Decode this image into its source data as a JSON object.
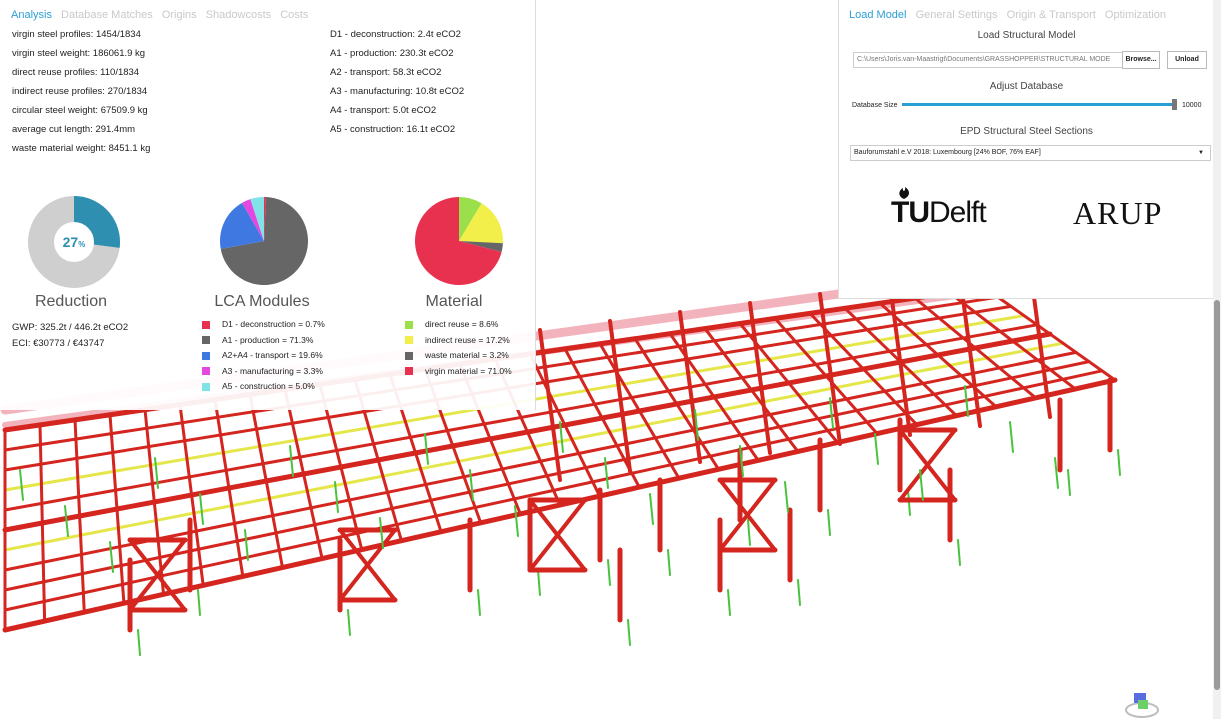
{
  "left": {
    "tabs": [
      "Analysis",
      "Database Matches",
      "Origins",
      "Shadowcosts",
      "Costs"
    ],
    "stats": [
      "virgin steel profiles: 1454/1834",
      "virgin steel weight: 186061.9 kg",
      "direct reuse profiles: 110/1834",
      "indirect reuse profiles: 270/1834",
      "circular steel weight: 67509.9 kg",
      "average cut length: 291.4mm",
      "waste material weight: 8451.1 kg"
    ],
    "lca_stats": [
      "D1 - deconstruction: 2.4t eCO2",
      "A1 - production: 230.3t eCO2",
      "A2 - transport: 58.3t eCO2",
      "A3 - manufacturing: 10.8t eCO2",
      "A4 - transport: 5.0t eCO2",
      "A5 - construction: 16.1t eCO2"
    ],
    "reduction": {
      "title": "Reduction",
      "percent_label": "27",
      "percent_sign": "%",
      "value": 0.27,
      "color": "#2e8fb0",
      "rest_color": "#cfcfcf"
    },
    "lca": {
      "title": "LCA Modules",
      "items": [
        {
          "label": "D1 - deconstruction = 0.7%",
          "value": 0.7,
          "color": "#e8304f"
        },
        {
          "label": "A1 - production = 71.3%",
          "value": 71.3,
          "color": "#666666"
        },
        {
          "label": "A2+A4 - transport = 19.6%",
          "value": 19.6,
          "color": "#3f78e0"
        },
        {
          "label": "A3 - manufacturing = 3.3%",
          "value": 3.3,
          "color": "#e548e0"
        },
        {
          "label": "A5 - construction = 5.0%",
          "value": 5.0,
          "color": "#7fe3e8"
        }
      ]
    },
    "material": {
      "title": "Material",
      "items": [
        {
          "label": "direct reuse = 8.6%",
          "value": 8.6,
          "color": "#9be04a"
        },
        {
          "label": "indirect reuse = 17.2%",
          "value": 17.2,
          "color": "#f2ee4a"
        },
        {
          "label": "waste material = 3.2%",
          "value": 3.2,
          "color": "#666666"
        },
        {
          "label": "virgin material = 71.0%",
          "value": 71.0,
          "color": "#e8304f"
        }
      ]
    },
    "gwp": "GWP:  325.2t / 446.2t eCO2",
    "eci": "ECI:   €30773 / €43747"
  },
  "right": {
    "tabs": [
      "Load Model",
      "General Settings",
      "Origin & Transport",
      "Optimization"
    ],
    "load_title": "Load Structural Model",
    "path": "C:\\Users\\Joris.van-Maastrigt\\Documents\\GRASSHOPPER\\STRUCTURAL MODE",
    "browse": "Browse...",
    "unload": "Unload",
    "adjust_title": "Adjust Database",
    "db_size_label": "Database Size",
    "db_size_value": "10000",
    "db_size_fraction": 1.0,
    "epd_title": "EPD Structural Steel Sections",
    "epd_selected": "Bauforumstahl e.V 2018: Luxembourg [24% BOF, 76% EAF]",
    "logo_tu_1": "TU",
    "logo_tu_2": "Delft",
    "logo_arup": "ARUP"
  }
}
